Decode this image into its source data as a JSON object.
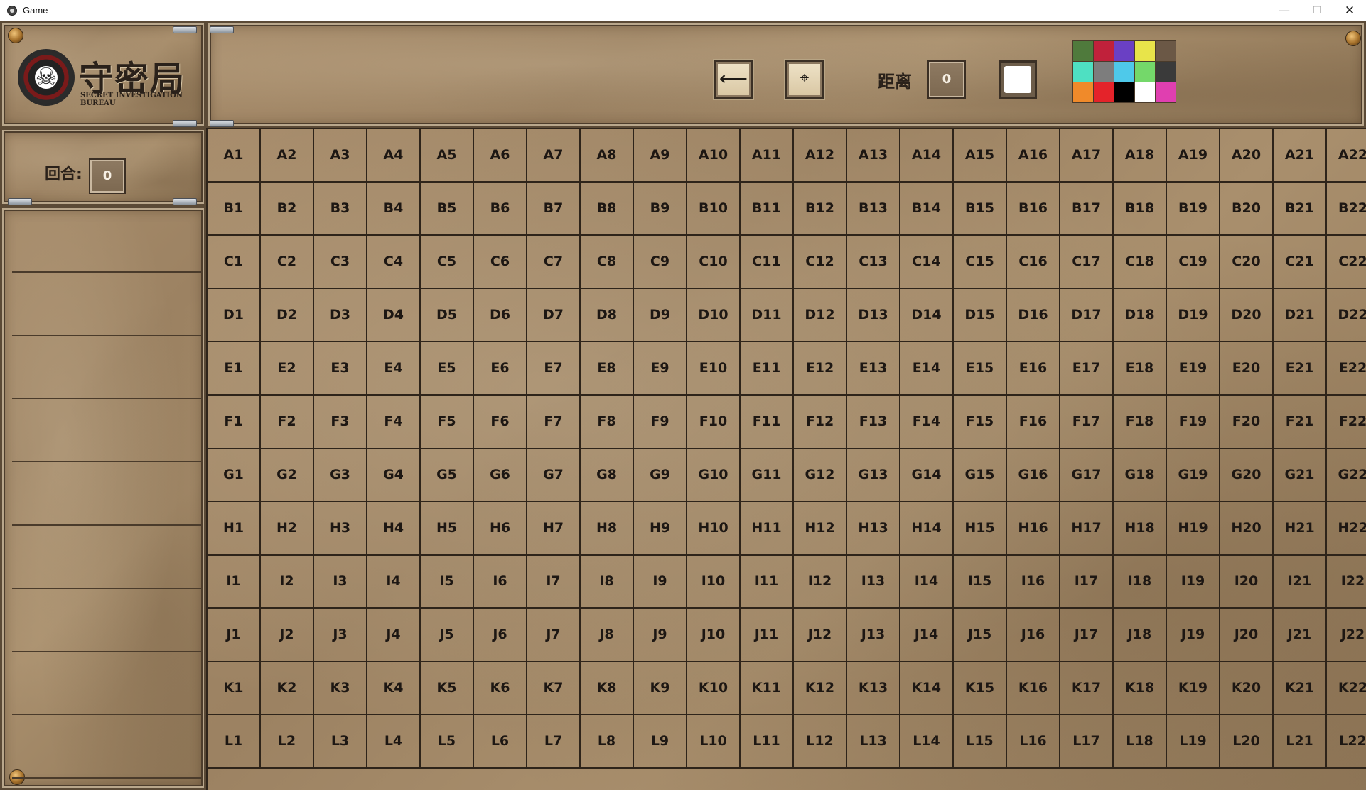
{
  "window": {
    "title": "Game",
    "minimize_glyph": "—",
    "maximize_glyph": "☐",
    "close_glyph": "✕"
  },
  "logo": {
    "title": "守密局",
    "subtitle": "SECRET INVESTIGATION BUREAU",
    "emblem_icon": "skull-gear-emblem"
  },
  "round": {
    "label": "回合:",
    "value": "0"
  },
  "toolbar": {
    "back_icon": "left-arrow-icon",
    "back_glyph": "⟵",
    "focus_icon": "crosshair-focus-icon",
    "focus_glyph": "⌖",
    "distance_label": "距离",
    "distance_value": "0",
    "selected_color": "#ffffff"
  },
  "palette": [
    [
      "#4f7a3c",
      "#c0213b",
      "#6a40c4",
      "#e8e44a",
      "#6b5846"
    ],
    [
      "#4ee0c2",
      "#7d7d7d",
      "#4ec9ea",
      "#74d86a",
      "#3a3a3a"
    ],
    [
      "#f08a2a",
      "#e4232a",
      "#000000",
      "#ffffff",
      "#e03fb0"
    ]
  ],
  "side_list": {
    "rows": [
      "",
      "",
      "",
      "",
      "",
      "",
      "",
      "",
      ""
    ]
  },
  "grid": {
    "rows": [
      "A",
      "B",
      "C",
      "D",
      "E",
      "F",
      "G",
      "H",
      "I",
      "J",
      "K",
      "L"
    ],
    "columns": [
      1,
      2,
      3,
      4,
      5,
      6,
      7,
      8,
      9,
      10,
      11,
      12,
      13,
      14,
      15,
      16,
      17,
      18,
      19,
      20,
      21,
      22
    ]
  }
}
